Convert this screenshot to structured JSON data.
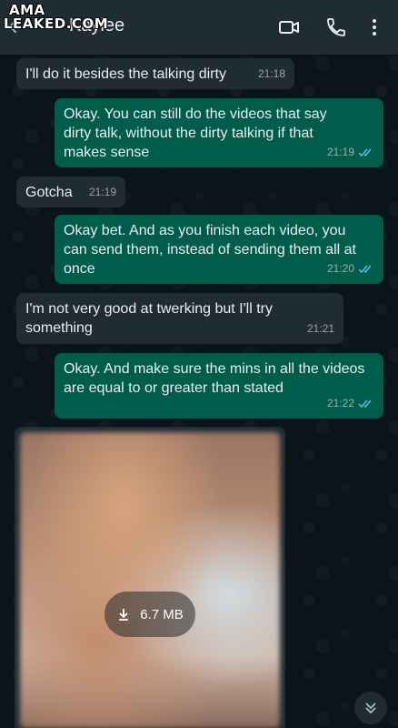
{
  "header": {
    "contact_name": "Kaylee",
    "watermark_line1": "AMA",
    "watermark_line2": "LEAKED.COM"
  },
  "messages": [
    {
      "direction": "in",
      "text": "I'll do it besides the talking dirty",
      "time": "21:18"
    },
    {
      "direction": "out",
      "text": "Okay. You can still do the videos that say dirty talk, without the dirty talking if that makes sense",
      "time": "21:19",
      "status": "read"
    },
    {
      "direction": "in",
      "text": "Gotcha",
      "time": "21:19"
    },
    {
      "direction": "out",
      "text": "Okay bet. And as you finish each video, you can send them, instead of sending them all at once",
      "time": "21:20",
      "status": "read"
    },
    {
      "direction": "in",
      "text": "I'm not very good at twerking but I'll try something",
      "time": "21:21"
    },
    {
      "direction": "out",
      "text": "Okay. And make sure the mins in all the videos are equal to or greater than stated",
      "time": "21:22",
      "status": "read"
    }
  ],
  "media": {
    "size_label": "6.7 MB"
  },
  "colors": {
    "background": "#0b141a",
    "header": "#1f2c33",
    "incoming_bubble": "#202c33",
    "outgoing_bubble": "#005c4b",
    "read_tick": "#53bdeb"
  }
}
